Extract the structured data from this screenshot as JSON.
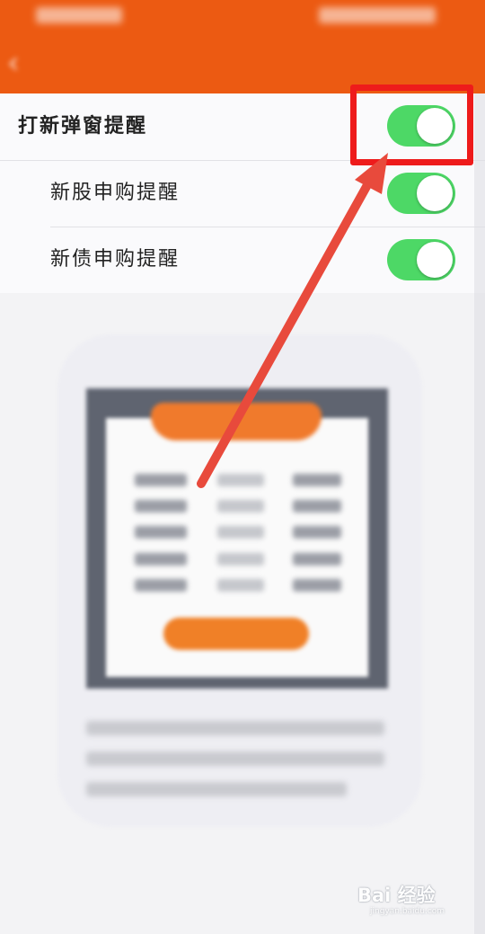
{
  "header": {
    "title": "",
    "back_icon": "back-arrow-icon",
    "background_color": "#ec5a12"
  },
  "settings": {
    "rows": [
      {
        "label": "打新弹窗提醒",
        "enabled": true
      },
      {
        "label": "新股申购提醒",
        "enabled": true
      },
      {
        "label": "新债申购提醒",
        "enabled": true
      }
    ],
    "toggle_on_color": "#4dd866"
  },
  "annotation": {
    "box_color": "#ee1b1b",
    "arrow_color": "#e84a3c"
  },
  "watermark": {
    "logo": "Bai 经验",
    "url": "jingyan.baidu.com"
  }
}
